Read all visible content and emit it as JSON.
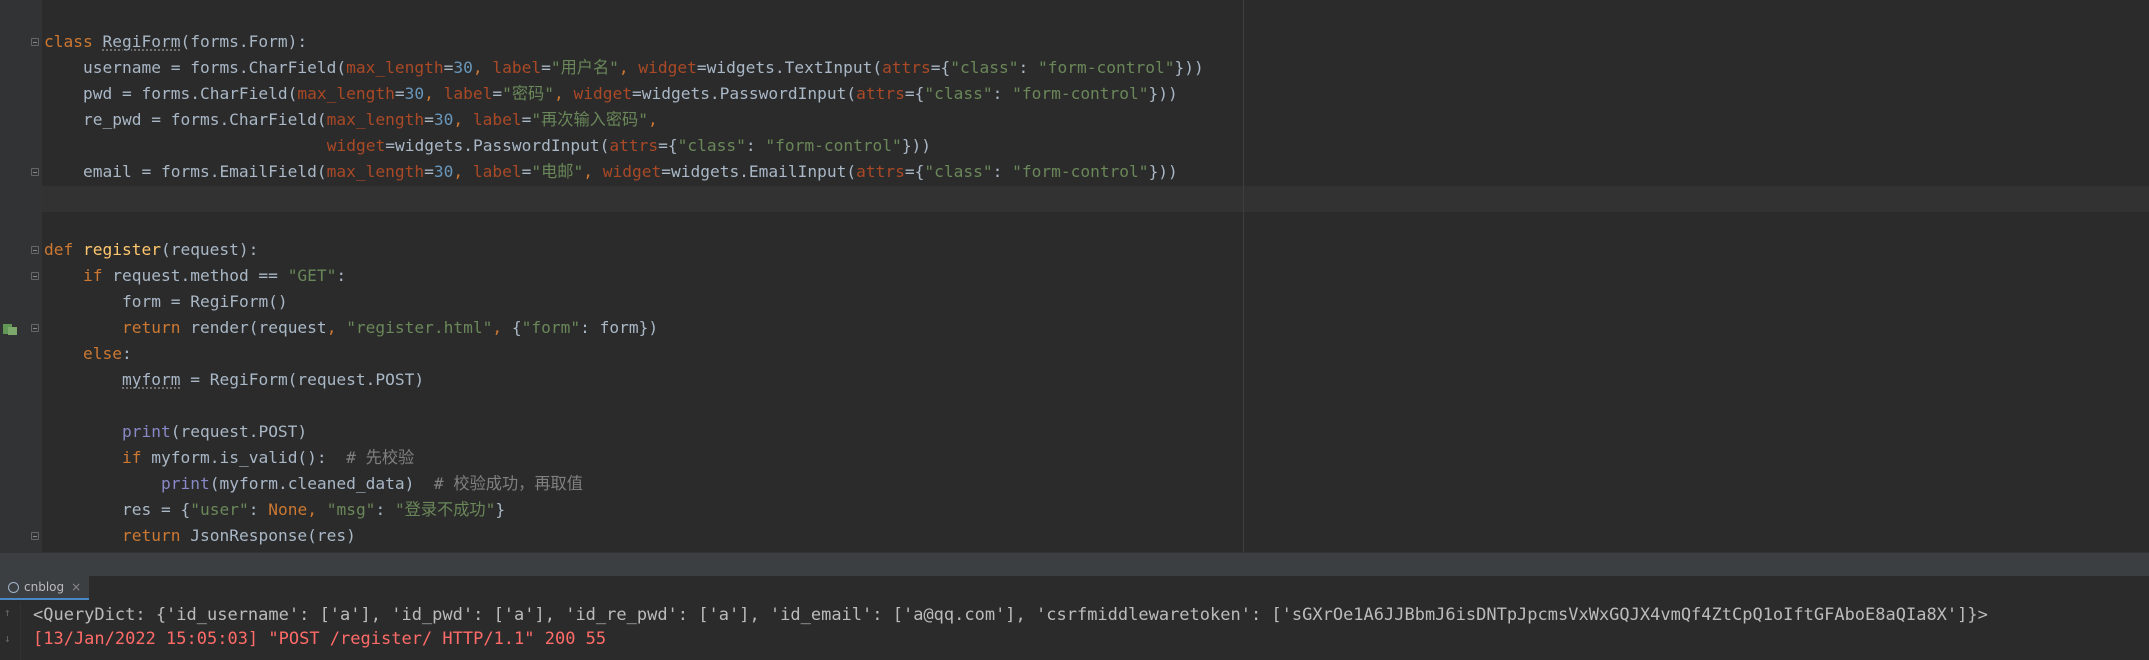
{
  "editor": {
    "lines": [
      {
        "fold": true,
        "indent": 0,
        "tokens": [
          {
            "t": "kw",
            "v": "class "
          },
          {
            "t": "ul",
            "v": "RegiForm"
          },
          {
            "t": "plain",
            "v": "(forms.Form):"
          }
        ]
      },
      {
        "fold": false,
        "indent": 4,
        "tokens": [
          {
            "t": "plain",
            "v": "username = forms.CharField("
          },
          {
            "t": "prm",
            "v": "max_length"
          },
          {
            "t": "plain",
            "v": "="
          },
          {
            "t": "num",
            "v": "30"
          },
          {
            "t": "kw",
            "v": ", "
          },
          {
            "t": "prm",
            "v": "label"
          },
          {
            "t": "plain",
            "v": "="
          },
          {
            "t": "str",
            "v": "\"用户名\""
          },
          {
            "t": "kw",
            "v": ", "
          },
          {
            "t": "prm",
            "v": "widget"
          },
          {
            "t": "plain",
            "v": "=widgets.TextInput("
          },
          {
            "t": "prm",
            "v": "attrs"
          },
          {
            "t": "plain",
            "v": "={"
          },
          {
            "t": "str",
            "v": "\"class\""
          },
          {
            "t": "plain",
            "v": ": "
          },
          {
            "t": "str",
            "v": "\"form-control\""
          },
          {
            "t": "plain",
            "v": "}))"
          }
        ]
      },
      {
        "fold": false,
        "indent": 4,
        "tokens": [
          {
            "t": "plain",
            "v": "pwd = forms.CharField("
          },
          {
            "t": "prm",
            "v": "max_length"
          },
          {
            "t": "plain",
            "v": "="
          },
          {
            "t": "num",
            "v": "30"
          },
          {
            "t": "kw",
            "v": ", "
          },
          {
            "t": "prm",
            "v": "label"
          },
          {
            "t": "plain",
            "v": "="
          },
          {
            "t": "str",
            "v": "\"密码\""
          },
          {
            "t": "kw",
            "v": ", "
          },
          {
            "t": "prm",
            "v": "widget"
          },
          {
            "t": "plain",
            "v": "=widgets.PasswordInput("
          },
          {
            "t": "prm",
            "v": "attrs"
          },
          {
            "t": "plain",
            "v": "={"
          },
          {
            "t": "str",
            "v": "\"class\""
          },
          {
            "t": "plain",
            "v": ": "
          },
          {
            "t": "str",
            "v": "\"form-control\""
          },
          {
            "t": "plain",
            "v": "}))"
          }
        ]
      },
      {
        "fold": false,
        "indent": 4,
        "tokens": [
          {
            "t": "plain",
            "v": "re_pwd = forms.CharField("
          },
          {
            "t": "prm",
            "v": "max_length"
          },
          {
            "t": "plain",
            "v": "="
          },
          {
            "t": "num",
            "v": "30"
          },
          {
            "t": "kw",
            "v": ", "
          },
          {
            "t": "prm",
            "v": "label"
          },
          {
            "t": "plain",
            "v": "="
          },
          {
            "t": "str",
            "v": "\"再次输入密码\""
          },
          {
            "t": "kw",
            "v": ","
          }
        ]
      },
      {
        "fold": false,
        "indent": 29,
        "tokens": [
          {
            "t": "prm",
            "v": "widget"
          },
          {
            "t": "plain",
            "v": "=widgets.PasswordInput("
          },
          {
            "t": "prm",
            "v": "attrs"
          },
          {
            "t": "plain",
            "v": "={"
          },
          {
            "t": "str",
            "v": "\"class\""
          },
          {
            "t": "plain",
            "v": ": "
          },
          {
            "t": "str",
            "v": "\"form-control\""
          },
          {
            "t": "plain",
            "v": "}))"
          }
        ]
      },
      {
        "fold": true,
        "indent": 4,
        "tokens": [
          {
            "t": "plain",
            "v": "email = forms.EmailField("
          },
          {
            "t": "prm",
            "v": "max_length"
          },
          {
            "t": "plain",
            "v": "="
          },
          {
            "t": "num",
            "v": "30"
          },
          {
            "t": "kw",
            "v": ", "
          },
          {
            "t": "prm",
            "v": "label"
          },
          {
            "t": "plain",
            "v": "="
          },
          {
            "t": "str",
            "v": "\"电邮\""
          },
          {
            "t": "kw",
            "v": ", "
          },
          {
            "t": "prm",
            "v": "widget"
          },
          {
            "t": "plain",
            "v": "=widgets.EmailInput("
          },
          {
            "t": "prm",
            "v": "attrs"
          },
          {
            "t": "plain",
            "v": "={"
          },
          {
            "t": "str",
            "v": "\"class\""
          },
          {
            "t": "plain",
            "v": ": "
          },
          {
            "t": "str",
            "v": "\"form-control\""
          },
          {
            "t": "plain",
            "v": "}))"
          }
        ]
      },
      {
        "fold": false,
        "indent": 0,
        "tokens": []
      },
      {
        "fold": false,
        "indent": 0,
        "tokens": []
      },
      {
        "fold": true,
        "indent": 0,
        "tokens": [
          {
            "t": "kw",
            "v": "def "
          },
          {
            "t": "fn",
            "v": "register"
          },
          {
            "t": "plain",
            "v": "(request):"
          }
        ]
      },
      {
        "fold": true,
        "indent": 4,
        "tokens": [
          {
            "t": "kw",
            "v": "if "
          },
          {
            "t": "plain",
            "v": "request.method == "
          },
          {
            "t": "str",
            "v": "\"GET\""
          },
          {
            "t": "plain",
            "v": ":"
          }
        ]
      },
      {
        "fold": false,
        "indent": 8,
        "tokens": [
          {
            "t": "plain",
            "v": "form = RegiForm()"
          }
        ]
      },
      {
        "fold": true,
        "run": true,
        "indent": 8,
        "tokens": [
          {
            "t": "kw",
            "v": "return "
          },
          {
            "t": "plain",
            "v": "render(request"
          },
          {
            "t": "kw",
            "v": ", "
          },
          {
            "t": "str",
            "v": "\"register.html\""
          },
          {
            "t": "kw",
            "v": ", "
          },
          {
            "t": "plain",
            "v": "{"
          },
          {
            "t": "str",
            "v": "\"form\""
          },
          {
            "t": "plain",
            "v": ": form})"
          }
        ]
      },
      {
        "fold": false,
        "indent": 4,
        "tokens": [
          {
            "t": "kw",
            "v": "else"
          },
          {
            "t": "plain",
            "v": ":"
          }
        ]
      },
      {
        "fold": false,
        "indent": 8,
        "tokens": [
          {
            "t": "ul",
            "v": "myform"
          },
          {
            "t": "plain",
            "v": " = RegiForm(request.POST)"
          }
        ]
      },
      {
        "fold": false,
        "indent": 0,
        "tokens": []
      },
      {
        "fold": false,
        "indent": 8,
        "tokens": [
          {
            "t": "bi",
            "v": "print"
          },
          {
            "t": "plain",
            "v": "(request.POST)"
          }
        ]
      },
      {
        "fold": false,
        "indent": 8,
        "tokens": [
          {
            "t": "kw",
            "v": "if "
          },
          {
            "t": "plain",
            "v": "myform.is_valid():  "
          },
          {
            "t": "cm",
            "v": "# 先校验"
          }
        ]
      },
      {
        "fold": false,
        "indent": 12,
        "tokens": [
          {
            "t": "bi",
            "v": "print"
          },
          {
            "t": "plain",
            "v": "(myform.cleaned_data)  "
          },
          {
            "t": "cm",
            "v": "# 校验成功，再取值"
          }
        ]
      },
      {
        "fold": false,
        "indent": 8,
        "tokens": [
          {
            "t": "plain",
            "v": "res = {"
          },
          {
            "t": "str",
            "v": "\"user\""
          },
          {
            "t": "plain",
            "v": ": "
          },
          {
            "t": "kw",
            "v": "None"
          },
          {
            "t": "kw",
            "v": ", "
          },
          {
            "t": "str",
            "v": "\"msg\""
          },
          {
            "t": "plain",
            "v": ": "
          },
          {
            "t": "str",
            "v": "\"登录不成功\""
          },
          {
            "t": "plain",
            "v": "}"
          }
        ]
      },
      {
        "fold": true,
        "indent": 8,
        "tokens": [
          {
            "t": "kw",
            "v": "return "
          },
          {
            "t": "plain",
            "v": "JsonResponse(res)"
          }
        ]
      }
    ]
  },
  "run_panel": {
    "tab_label": "cnblog",
    "tab_close": "×",
    "output": [
      "<QueryDict: {'id_username': ['a'], 'id_pwd': ['a'], 'id_re_pwd': ['a'], 'id_email': ['a@qq.com'], 'csrfmiddlewaretoken': ['sGXrOe1A6JJBbmJ6isDNTpJpcmsVxWxGQJX4vmQf4ZtCpQ1oIftGFAboE8aQIa8X']}>",
      "[13/Jan/2022 15:05:03] \"POST /register/ HTTP/1.1\" 200 55"
    ]
  },
  "colors": {
    "background": "#2b2b2b",
    "keyword": "#cc7832",
    "string": "#6a8759",
    "number": "#6897bb",
    "param": "#aa4926",
    "function": "#ffc66d",
    "builtin": "#8888c6",
    "comment": "#808080",
    "error_output": "#ff6b68"
  }
}
